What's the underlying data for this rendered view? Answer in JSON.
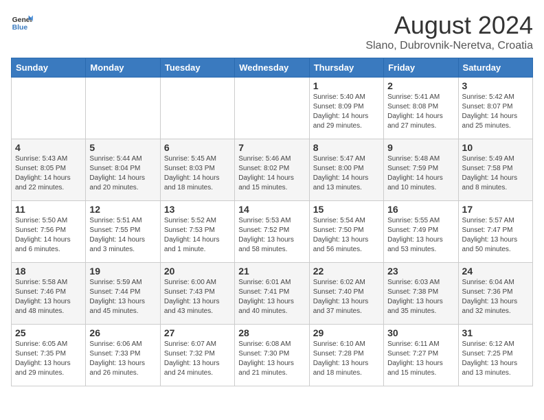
{
  "header": {
    "logo_general": "General",
    "logo_blue": "Blue",
    "month_title": "August 2024",
    "location": "Slano, Dubrovnik-Neretva, Croatia"
  },
  "days_of_week": [
    "Sunday",
    "Monday",
    "Tuesday",
    "Wednesday",
    "Thursday",
    "Friday",
    "Saturday"
  ],
  "weeks": [
    [
      {
        "day": "",
        "info": ""
      },
      {
        "day": "",
        "info": ""
      },
      {
        "day": "",
        "info": ""
      },
      {
        "day": "",
        "info": ""
      },
      {
        "day": "1",
        "info": "Sunrise: 5:40 AM\nSunset: 8:09 PM\nDaylight: 14 hours\nand 29 minutes."
      },
      {
        "day": "2",
        "info": "Sunrise: 5:41 AM\nSunset: 8:08 PM\nDaylight: 14 hours\nand 27 minutes."
      },
      {
        "day": "3",
        "info": "Sunrise: 5:42 AM\nSunset: 8:07 PM\nDaylight: 14 hours\nand 25 minutes."
      }
    ],
    [
      {
        "day": "4",
        "info": "Sunrise: 5:43 AM\nSunset: 8:05 PM\nDaylight: 14 hours\nand 22 minutes."
      },
      {
        "day": "5",
        "info": "Sunrise: 5:44 AM\nSunset: 8:04 PM\nDaylight: 14 hours\nand 20 minutes."
      },
      {
        "day": "6",
        "info": "Sunrise: 5:45 AM\nSunset: 8:03 PM\nDaylight: 14 hours\nand 18 minutes."
      },
      {
        "day": "7",
        "info": "Sunrise: 5:46 AM\nSunset: 8:02 PM\nDaylight: 14 hours\nand 15 minutes."
      },
      {
        "day": "8",
        "info": "Sunrise: 5:47 AM\nSunset: 8:00 PM\nDaylight: 14 hours\nand 13 minutes."
      },
      {
        "day": "9",
        "info": "Sunrise: 5:48 AM\nSunset: 7:59 PM\nDaylight: 14 hours\nand 10 minutes."
      },
      {
        "day": "10",
        "info": "Sunrise: 5:49 AM\nSunset: 7:58 PM\nDaylight: 14 hours\nand 8 minutes."
      }
    ],
    [
      {
        "day": "11",
        "info": "Sunrise: 5:50 AM\nSunset: 7:56 PM\nDaylight: 14 hours\nand 6 minutes."
      },
      {
        "day": "12",
        "info": "Sunrise: 5:51 AM\nSunset: 7:55 PM\nDaylight: 14 hours\nand 3 minutes."
      },
      {
        "day": "13",
        "info": "Sunrise: 5:52 AM\nSunset: 7:53 PM\nDaylight: 14 hours\nand 1 minute."
      },
      {
        "day": "14",
        "info": "Sunrise: 5:53 AM\nSunset: 7:52 PM\nDaylight: 13 hours\nand 58 minutes."
      },
      {
        "day": "15",
        "info": "Sunrise: 5:54 AM\nSunset: 7:50 PM\nDaylight: 13 hours\nand 56 minutes."
      },
      {
        "day": "16",
        "info": "Sunrise: 5:55 AM\nSunset: 7:49 PM\nDaylight: 13 hours\nand 53 minutes."
      },
      {
        "day": "17",
        "info": "Sunrise: 5:57 AM\nSunset: 7:47 PM\nDaylight: 13 hours\nand 50 minutes."
      }
    ],
    [
      {
        "day": "18",
        "info": "Sunrise: 5:58 AM\nSunset: 7:46 PM\nDaylight: 13 hours\nand 48 minutes."
      },
      {
        "day": "19",
        "info": "Sunrise: 5:59 AM\nSunset: 7:44 PM\nDaylight: 13 hours\nand 45 minutes."
      },
      {
        "day": "20",
        "info": "Sunrise: 6:00 AM\nSunset: 7:43 PM\nDaylight: 13 hours\nand 43 minutes."
      },
      {
        "day": "21",
        "info": "Sunrise: 6:01 AM\nSunset: 7:41 PM\nDaylight: 13 hours\nand 40 minutes."
      },
      {
        "day": "22",
        "info": "Sunrise: 6:02 AM\nSunset: 7:40 PM\nDaylight: 13 hours\nand 37 minutes."
      },
      {
        "day": "23",
        "info": "Sunrise: 6:03 AM\nSunset: 7:38 PM\nDaylight: 13 hours\nand 35 minutes."
      },
      {
        "day": "24",
        "info": "Sunrise: 6:04 AM\nSunset: 7:36 PM\nDaylight: 13 hours\nand 32 minutes."
      }
    ],
    [
      {
        "day": "25",
        "info": "Sunrise: 6:05 AM\nSunset: 7:35 PM\nDaylight: 13 hours\nand 29 minutes."
      },
      {
        "day": "26",
        "info": "Sunrise: 6:06 AM\nSunset: 7:33 PM\nDaylight: 13 hours\nand 26 minutes."
      },
      {
        "day": "27",
        "info": "Sunrise: 6:07 AM\nSunset: 7:32 PM\nDaylight: 13 hours\nand 24 minutes."
      },
      {
        "day": "28",
        "info": "Sunrise: 6:08 AM\nSunset: 7:30 PM\nDaylight: 13 hours\nand 21 minutes."
      },
      {
        "day": "29",
        "info": "Sunrise: 6:10 AM\nSunset: 7:28 PM\nDaylight: 13 hours\nand 18 minutes."
      },
      {
        "day": "30",
        "info": "Sunrise: 6:11 AM\nSunset: 7:27 PM\nDaylight: 13 hours\nand 15 minutes."
      },
      {
        "day": "31",
        "info": "Sunrise: 6:12 AM\nSunset: 7:25 PM\nDaylight: 13 hours\nand 13 minutes."
      }
    ]
  ]
}
